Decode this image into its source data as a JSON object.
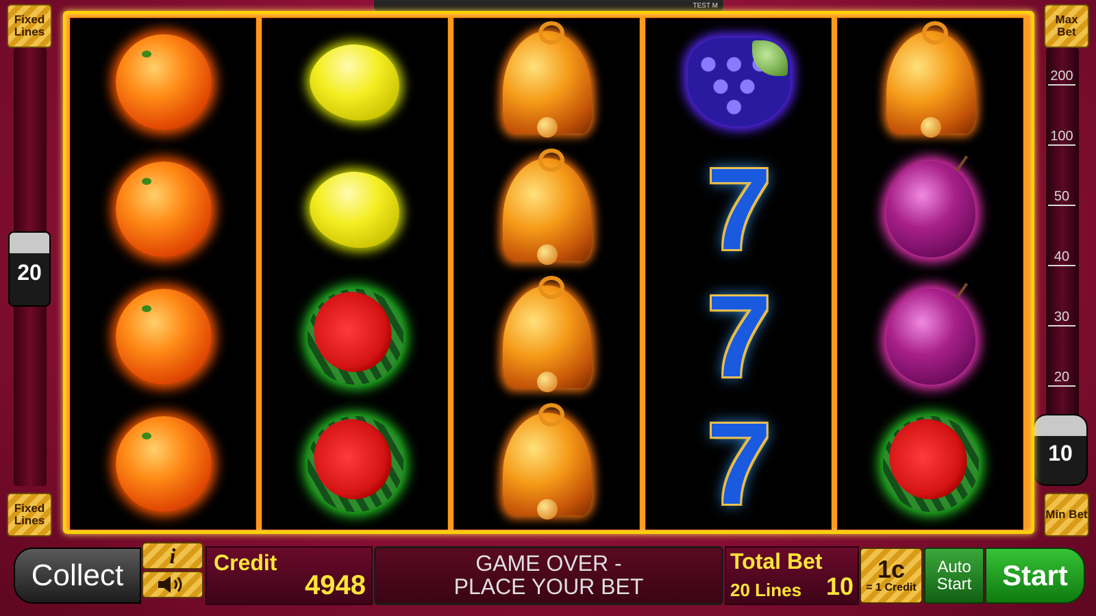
{
  "top_bar": {
    "label": "TEST M"
  },
  "left_panel": {
    "top_button": "Fixed Lines",
    "bottom_button": "Fixed Lines",
    "lines_value": "20"
  },
  "right_panel": {
    "max_bet": "Max Bet",
    "min_bet": "Min Bet",
    "bet_value": "10",
    "scale": [
      "200",
      "100",
      "50",
      "40",
      "30",
      "20"
    ]
  },
  "reels": [
    [
      "orange",
      "orange",
      "orange",
      "orange"
    ],
    [
      "lemon",
      "lemon",
      "melon",
      "melon"
    ],
    [
      "bell",
      "bell",
      "bell",
      "bell"
    ],
    [
      "grape",
      "seven",
      "seven",
      "seven"
    ],
    [
      "bell",
      "plum",
      "plum",
      "melon"
    ]
  ],
  "bottom": {
    "collect": "Collect",
    "info_icon": "i",
    "credit_label": "Credit",
    "credit_value": "4948",
    "message_line1": "GAME OVER -",
    "message_line2": "PLACE YOUR BET",
    "total_bet_label": "Total Bet",
    "lines_label": "20 Lines",
    "bet_value": "10",
    "denom_value": "1c",
    "denom_sub": "= 1 Credit",
    "auto_line1": "Auto",
    "auto_line2": "Start",
    "start": "Start"
  },
  "seven_glyph": "7"
}
